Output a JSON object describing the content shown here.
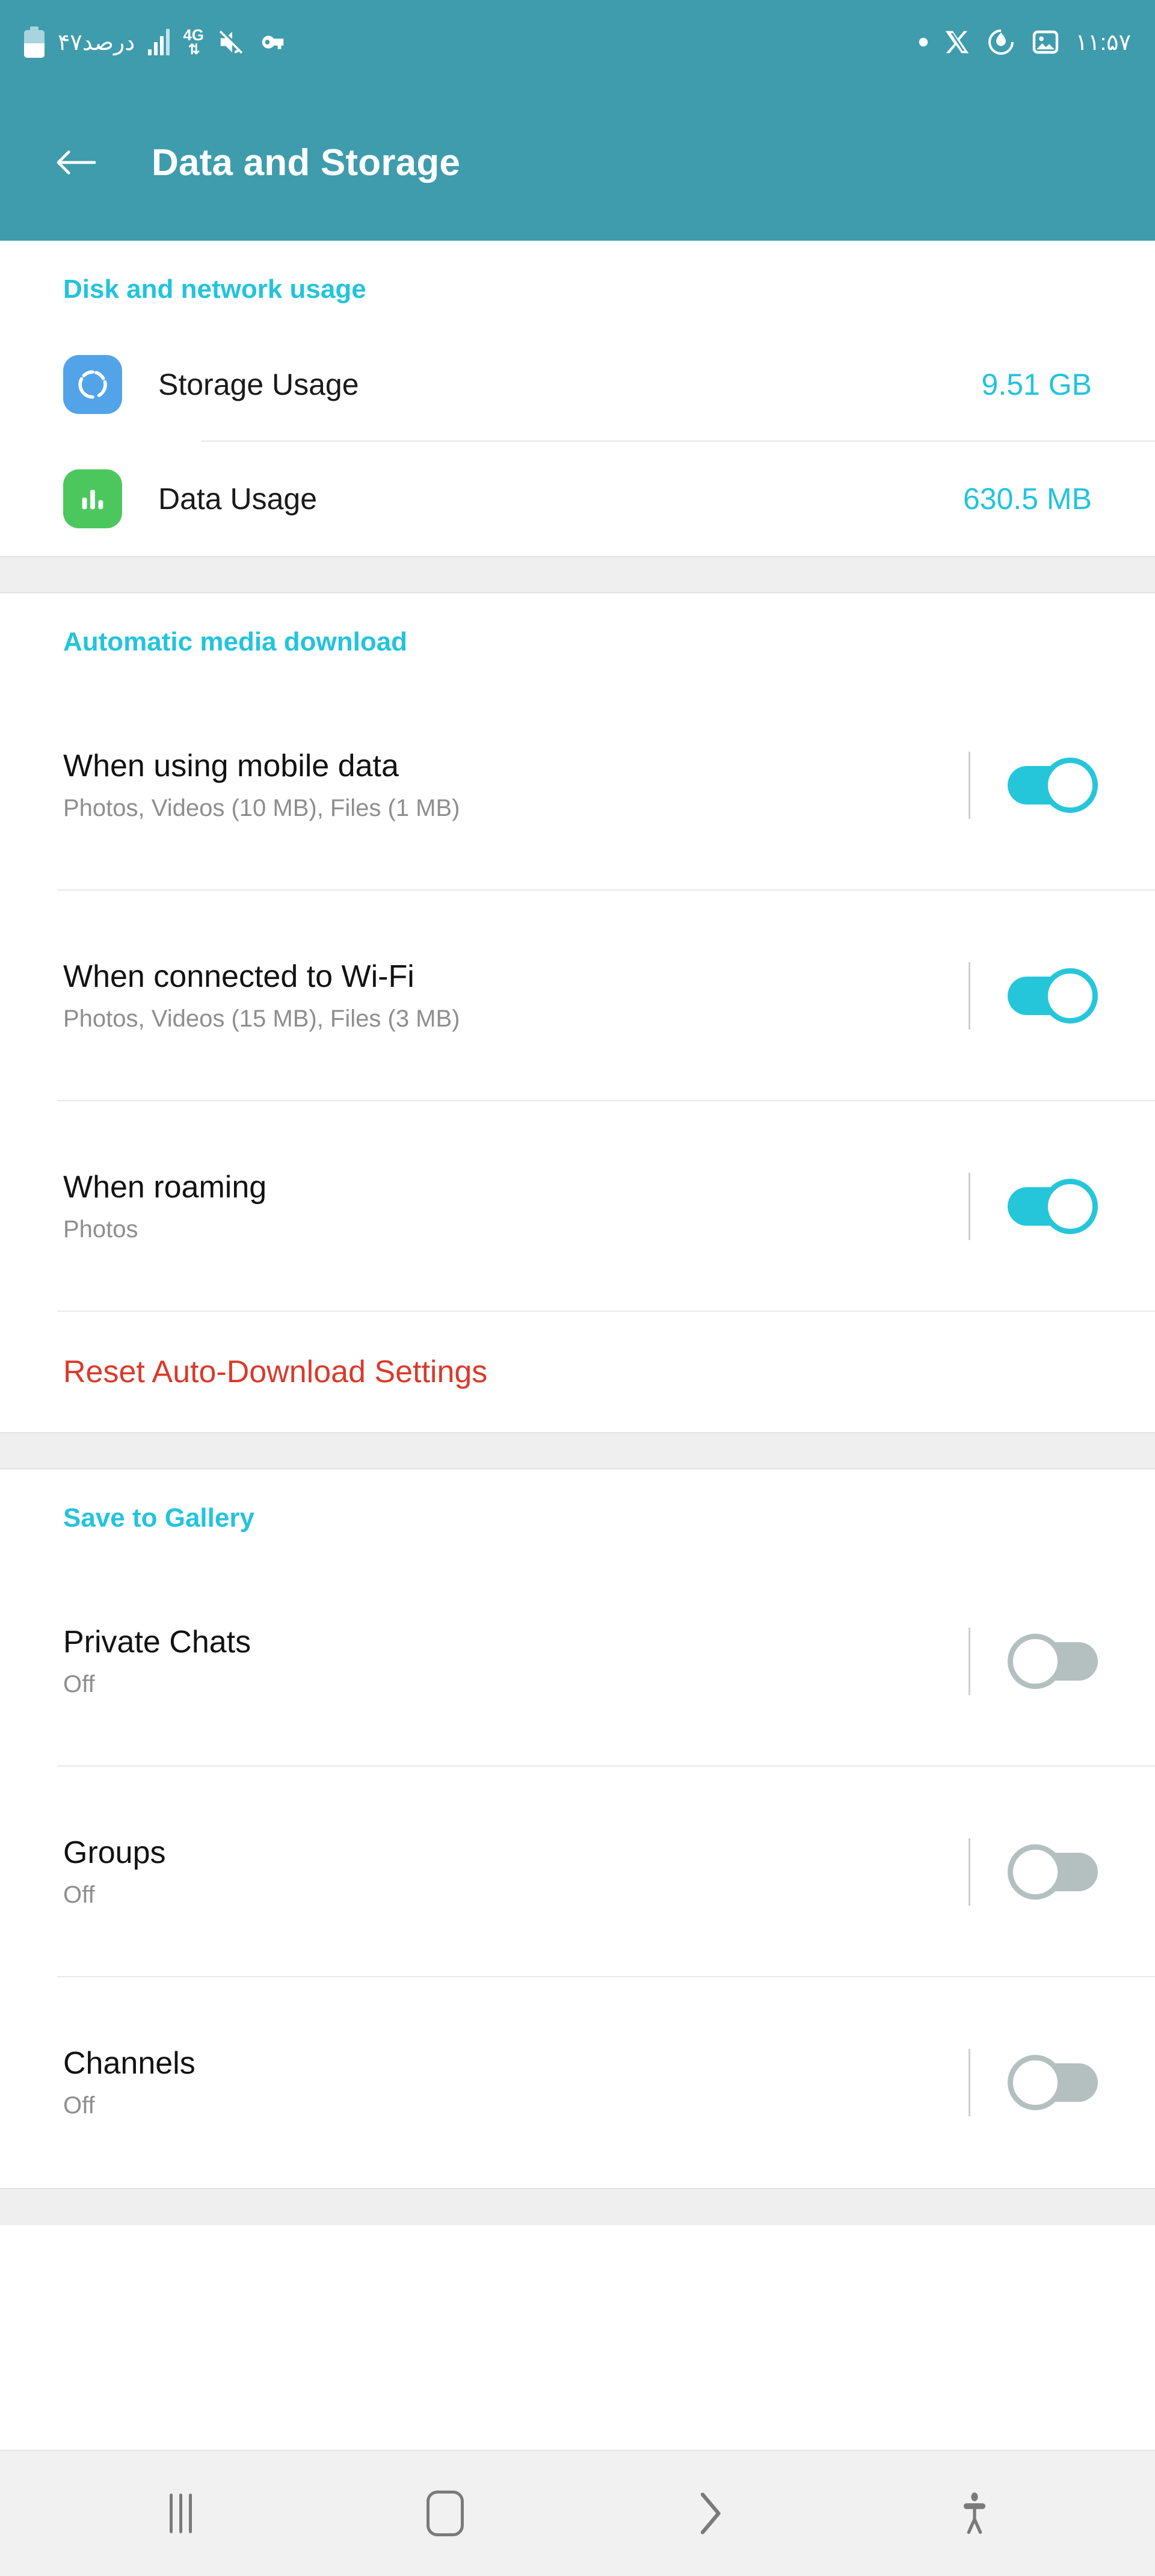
{
  "status_bar": {
    "battery_text": "۴۷درصد",
    "network_type": "4G",
    "time": "۱۱:۵۷",
    "left_icons": [
      "battery-icon",
      "signal-bars-icon",
      "4g-data-icon",
      "mute-icon",
      "vpn-key-icon"
    ],
    "right_icons": [
      "dot-indicator-icon",
      "x-app-icon",
      "power-saving-icon",
      "screenshot-image-icon"
    ]
  },
  "app_bar": {
    "back_label": "Back",
    "title": "Data and Storage"
  },
  "colors": {
    "header_bg": "#3E9CAD",
    "accent_cyan": "#22C4DC",
    "toggle_on": "#26C6DA",
    "toggle_off": "#B4C0C0",
    "danger_red": "#D93A2B",
    "storage_icon_bg": "#53A3E8",
    "data_icon_bg": "#4CC75E"
  },
  "sections": {
    "disk_network": {
      "header": "Disk and network usage",
      "rows": [
        {
          "label": "Storage Usage",
          "value": "9.51 GB",
          "icon": "storage-pie-icon"
        },
        {
          "label": "Data Usage",
          "value": "630.5 MB",
          "icon": "bar-chart-icon"
        }
      ]
    },
    "auto_download": {
      "header": "Automatic media download",
      "rows": [
        {
          "title": "When using mobile data",
          "subtitle": "Photos, Videos (10 MB), Files (1 MB)",
          "toggle": "on"
        },
        {
          "title": "When connected to Wi-Fi",
          "subtitle": "Photos, Videos (15 MB), Files (3 MB)",
          "toggle": "on"
        },
        {
          "title": "When roaming",
          "subtitle": "Photos",
          "toggle": "on"
        }
      ],
      "reset_label": "Reset Auto-Download Settings"
    },
    "save_to_gallery": {
      "header": "Save to Gallery",
      "rows": [
        {
          "title": "Private Chats",
          "subtitle": "Off",
          "toggle": "off"
        },
        {
          "title": "Groups",
          "subtitle": "Off",
          "toggle": "off"
        },
        {
          "title": "Channels",
          "subtitle": "Off",
          "toggle": "off"
        }
      ]
    }
  },
  "navbar": {
    "items": [
      "recents-button",
      "home-button",
      "back-chevron-button",
      "accessibility-button"
    ]
  }
}
